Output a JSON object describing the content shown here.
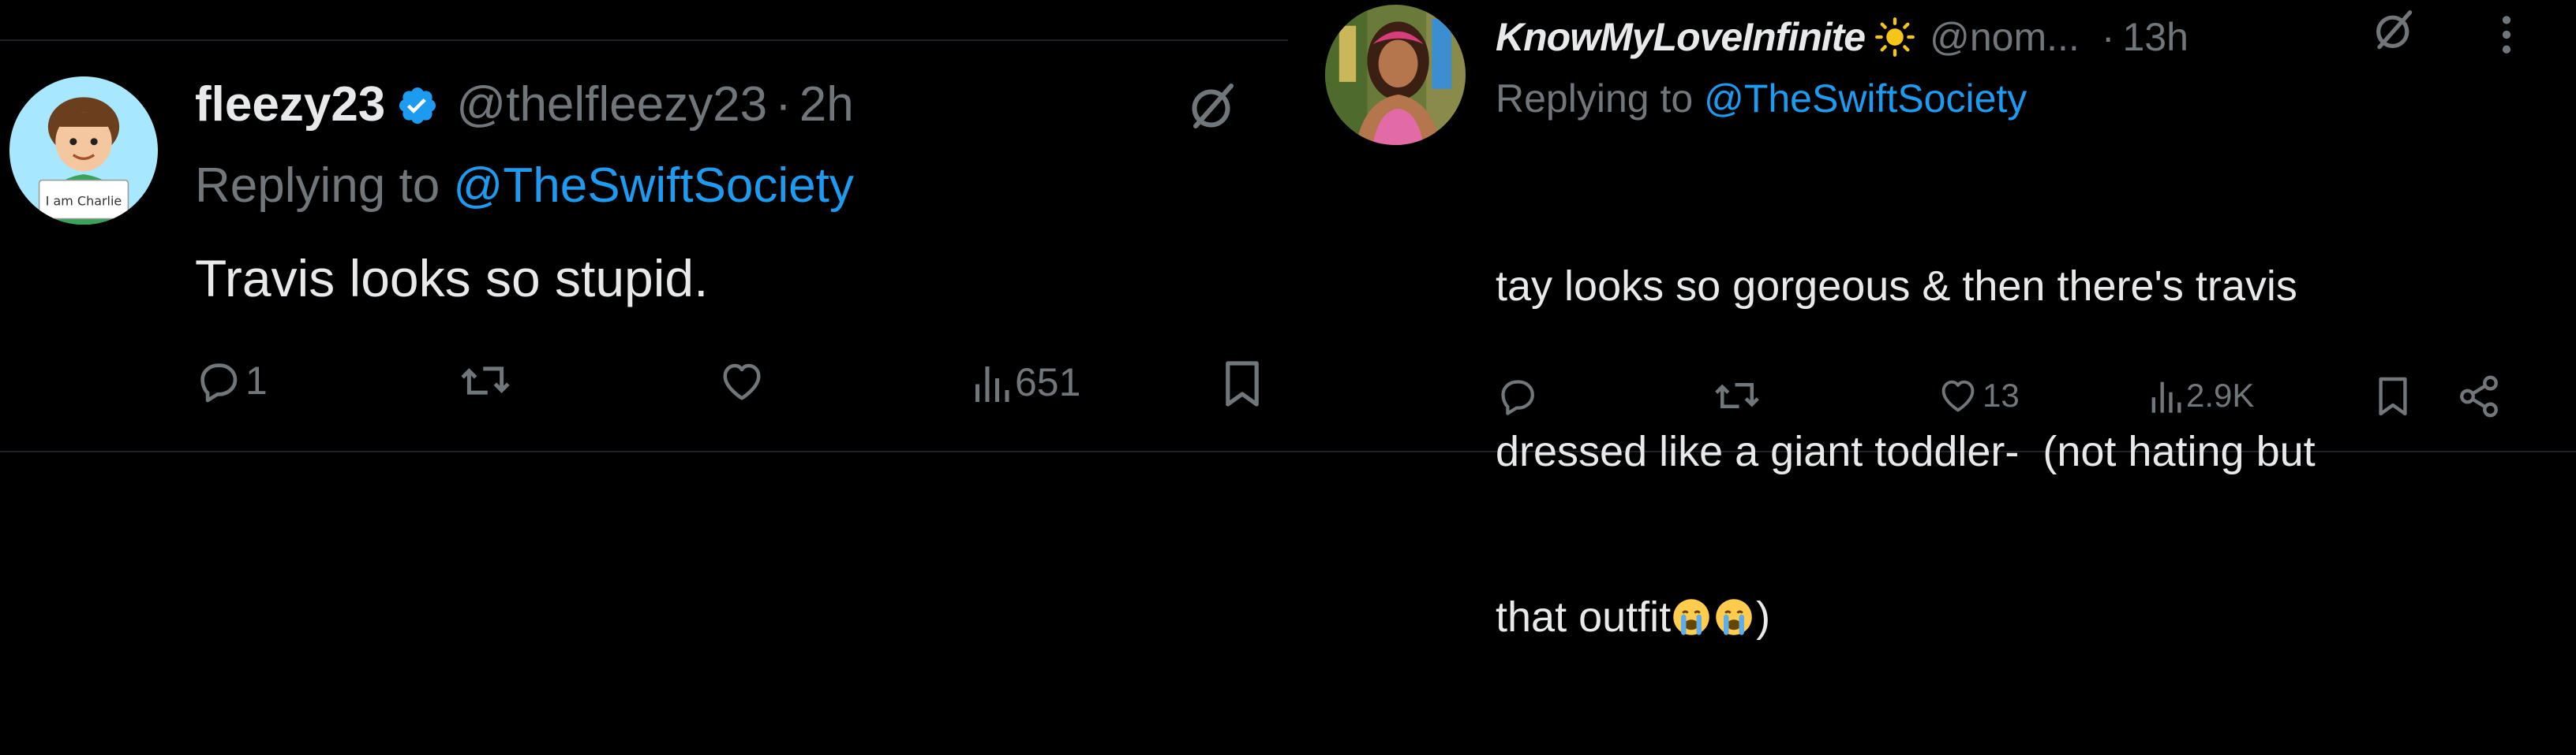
{
  "tweets": [
    {
      "author": {
        "display_name": "fleezy23",
        "verified": true,
        "handle": "@thelfleezy23",
        "avatar": "cartoon-boy-holding-sign-avatar",
        "avatar_sign_text": "I am Charlie"
      },
      "separator": "·",
      "time": "2h",
      "grok_icon": "grok-slash-icon",
      "replying_prefix": "Replying to",
      "replying_to": "@TheSwiftSociety",
      "body": "Travis looks so stupid.",
      "actions": {
        "reply": {
          "icon": "reply-bubble-icon",
          "count": "1"
        },
        "retweet": {
          "icon": "retweet-icon",
          "count": ""
        },
        "like": {
          "icon": "heart-icon",
          "count": ""
        },
        "views": {
          "icon": "views-bar-icon",
          "count": "651"
        },
        "bookmark": {
          "icon": "bookmark-icon"
        }
      }
    },
    {
      "author": {
        "display_name": "KnowMyLoveInfinite",
        "name_emoji": "☀️",
        "handle": "@nom...",
        "avatar": "person-photo-avatar"
      },
      "separator": "·",
      "time": "13h",
      "grok_icon": "grok-slash-icon",
      "more_icon": "more-vertical-icon",
      "replying_prefix": "Replying to",
      "replying_to": "@TheSwiftSociety",
      "body_line1": "tay looks so gorgeous & then there's travis",
      "body_line2": "dressed like a giant toddler-  (not hating but",
      "body_line3_text": "that outfit",
      "body_line3_emoji": "😭😭",
      "body_line3_end": ")",
      "actions": {
        "reply": {
          "icon": "reply-bubble-icon",
          "count": ""
        },
        "retweet": {
          "icon": "retweet-icon",
          "count": ""
        },
        "like": {
          "icon": "heart-icon",
          "count": "13"
        },
        "views": {
          "icon": "views-bar-icon",
          "count": "2.9K"
        },
        "bookmark": {
          "icon": "bookmark-icon"
        },
        "share": {
          "icon": "share-icon"
        }
      }
    }
  ],
  "colors": {
    "background": "#000000",
    "text_primary": "#e7e9ea",
    "text_secondary": "#71767b",
    "link": "#1d9bf0",
    "verified": "#1d9bf0",
    "sun_emoji": "#f5c518",
    "crying_emoji": "#ffcc4d",
    "tears": "#5dadec"
  }
}
